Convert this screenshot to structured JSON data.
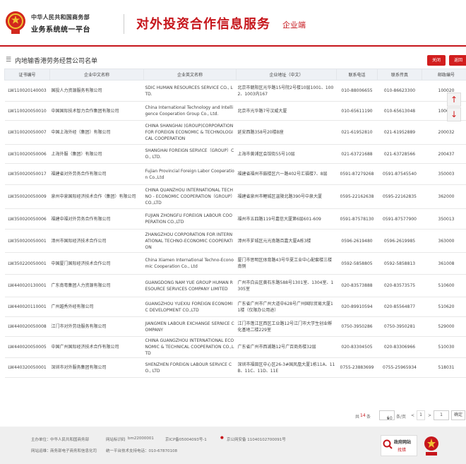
{
  "header": {
    "org_name": "中华人民共和国商务部",
    "system_name": "业务系统统一平台",
    "title": "对外投资合作信息服务",
    "subtitle": "企业端"
  },
  "section": {
    "title": "内地输香港劳务经营公司名单",
    "close_label": "关闭",
    "back_label": "返回"
  },
  "columns": [
    "证书编号",
    "企业中文名称",
    "企业英文名称",
    "企业地址（中文）",
    "联系电话",
    "联系传真",
    "邮政编号"
  ],
  "rows": [
    [
      "LW110020140003",
      "国投人力资源服务有限公司",
      "SDIC HUMAN RESOURCES SERVICE CO., LTD.",
      "北京市朝阳区光华路15号院2号楼10层1001、1002、1003内167",
      "010-88006655",
      "010-86623300",
      "100020"
    ],
    [
      "LW110020050010",
      "中国国际技术智力合作集团有限公司",
      "China International Technology and Intelligence Cooperation Group Co., Ltd.",
      "北京市光华路7号汉威大厦",
      "010-65611190",
      "010-65613048",
      "100004"
    ],
    [
      "LW310020050007",
      "中国上海外经（集团）有限公司",
      "CHINA SHANGHAI (GROUP)CORPORATION FOR FOREIGN ECONOMIC & TECHNOLOGICAL COOPERATION",
      "延安西路358号20楼B座",
      "021-61952810",
      "021-61952889",
      "200032"
    ],
    [
      "LW310020050006",
      "上海外服（集团）有限公司",
      "SHANGHAI FOREIGN SERVICE（GROUP）CO., LTD.",
      "上海市黄浦区会馆街55号10层",
      "021-63721688",
      "021-63728566",
      "200437"
    ],
    [
      "LW350020050017",
      "福建省对外劳务合作有限公司",
      "Fujian Provincial Foreign Labor Cooperation Co.,Ltd",
      "福建省福州市鼓楼区六一路402号汇福楼7、8层",
      "0591-87279268",
      "0591-87545540",
      "350003"
    ],
    [
      "LW350020050009",
      "泉州中泉国际经济技术合作（集团）有限公司",
      "CHINA QUANZHOU INTERNATIONAL TECHNO - ECONOMIC COOPERATION（GROUP）CO.,LTD",
      "福建省泉州市鲤城区温陵北路390号中泉大厦",
      "0595-22162638",
      "0595-22162835",
      "362000"
    ],
    [
      "LW350020050006",
      "福建中福对外劳务合作有限公司",
      "FUJIAN ZHONGFU FOREIGN LABOUR COOPERATION CO.,LTD",
      "福州市五四路119号嘉信大厦第6层601-609",
      "0591-87578130",
      "0591-87577900",
      "350013"
    ],
    [
      "LW350020050001",
      "漳州市国际经济技术合作公司",
      "ZHANGZHOU CORPORATION FOR INTERNATIONAL TECHNO-ECONOMIC COOPERATION",
      "漳州市芗城区元光南路百嘉大厦A栋3楼",
      "0596-2619480",
      "0596-2619985",
      "363000"
    ],
    [
      "LW350220050001",
      "中国厦门国际经济技术合作公司",
      "China Xiamen International Techno-Economic Cooperation Co., Ltd",
      "厦门市思明区体育路43号华夏工业中心配套楼三楼南侧",
      "0592-5858805",
      "0592-5858813",
      "361008"
    ],
    [
      "LW440020130001",
      "广东南粤集团人力资源有限公司",
      "GUANGDONG NAM YUE GROUP HUMAN RESOURCE SERVICES COMPANY LIMITED",
      "广州市白云区黄石东路588号1301室、1304室、1305室",
      "020-83573888",
      "020-83573575",
      "510600"
    ],
    [
      "LW440020110001",
      "广州越秀外经有限公司",
      "GUANGZHOU YUEXIU FOREIGN ECONOMIC DEVELOPMENT CO.,LTD",
      "广东省广州市广州大道中628号广州国际贸易大厦11楼（仅限办公用途）",
      "020-89910594",
      "020-85564877",
      "510620"
    ],
    [
      "LW440020050008",
      "江门市对外劳动服务有限公司",
      "JIANGMEN LABOUR EXCHANGE SERNICE COMPANY",
      "江门市蓬江区西区工业路12号江门市大学生创业孵化基地二楼229室",
      "0750-3950286",
      "0750-3950281",
      "529000"
    ],
    [
      "LW440020050005",
      "中国广州国际经济技术合作有限公司",
      "CHINA GUANGZHOU INTERNATIONAL ECONOMIC & TECHNICAL COOPERATION CO.,LTD",
      "广东省广州市西湖路12号广百商务楼32层",
      "020-83304505",
      "020-83306966",
      "510030"
    ],
    [
      "LW440320050001",
      "深圳市对外服务集团有限公司",
      "SHENZHEN FOREIGN LABOUR SERVICE CO., LTD",
      "深圳市福田区中心区26-3#国凤凰大厦1栋11A、11B、11C、11D、11E",
      "0755-23883699",
      "0755-25965934",
      "518031"
    ]
  ],
  "pager": {
    "total_prefix": "共",
    "total": "14",
    "total_suffix": "条",
    "per_page": "50",
    "per_page_suffix": "条/页",
    "prev": "<",
    "page": "1",
    "next": ">",
    "goto": "前往",
    "goto_value": "1",
    "confirm": "确定"
  },
  "footer": {
    "sponsor_label": "主办单位：",
    "sponsor": "中华人民共和国商务部",
    "site_code_label": "网站标识码",
    "site_code": "bm22000001",
    "icp": "京ICP备05004093号-1",
    "police": "京公网安备 11040102700091号",
    "ops_label": "网站运维：",
    "ops": "商务部电子商务和信息化司",
    "hotline": "统一平台技术支持电话：010-67870108",
    "gov_site": "政府网站",
    "find_error": "找错"
  },
  "icons": {
    "scroll_up": "arrow-up-icon",
    "scroll_down": "arrow-down-icon"
  },
  "colors": {
    "brand_red": "#c6161c",
    "button_red": "#d21e1e",
    "header_bg": "#eef1f5"
  }
}
